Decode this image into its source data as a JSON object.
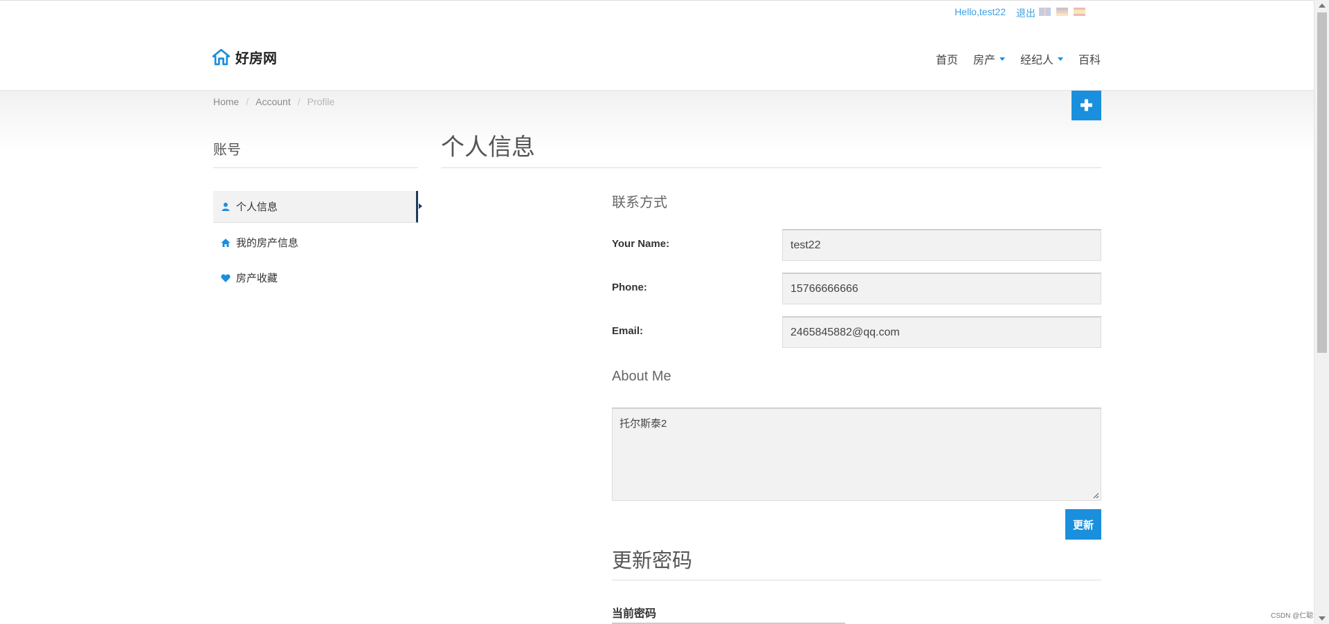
{
  "topbar": {
    "greeting": "Hello,test22",
    "logout": "退出"
  },
  "brand": {
    "name": "好房网",
    "accent": "#1a8fdd"
  },
  "nav": {
    "home": "首页",
    "property": "房产",
    "agent": "经纪人",
    "wiki": "百科"
  },
  "breadcrumb": {
    "home": "Home",
    "account": "Account",
    "profile": "Profile",
    "separator": "/"
  },
  "plus_button": {
    "label": "✚"
  },
  "sidebar": {
    "title": "账号",
    "items": [
      {
        "label": "个人信息",
        "icon": "user-icon",
        "active": true
      },
      {
        "label": "我的房产信息",
        "icon": "home-icon",
        "active": false
      },
      {
        "label": "房产收藏",
        "icon": "heart-icon",
        "active": false
      }
    ]
  },
  "main": {
    "title": "个人信息",
    "contact_title": "联系方式",
    "name_label": "Your Name:",
    "name_value": "test22",
    "phone_label": "Phone:",
    "phone_value": "15766666666",
    "email_label": "Email:",
    "email_value": "2465845882@qq.com",
    "about_title": "About Me",
    "about_value": "托尔斯泰2",
    "update_button": "更新",
    "password_title": "更新密码",
    "current_password_label": "当前密码"
  },
  "watermark": "CSDN @仁聪"
}
